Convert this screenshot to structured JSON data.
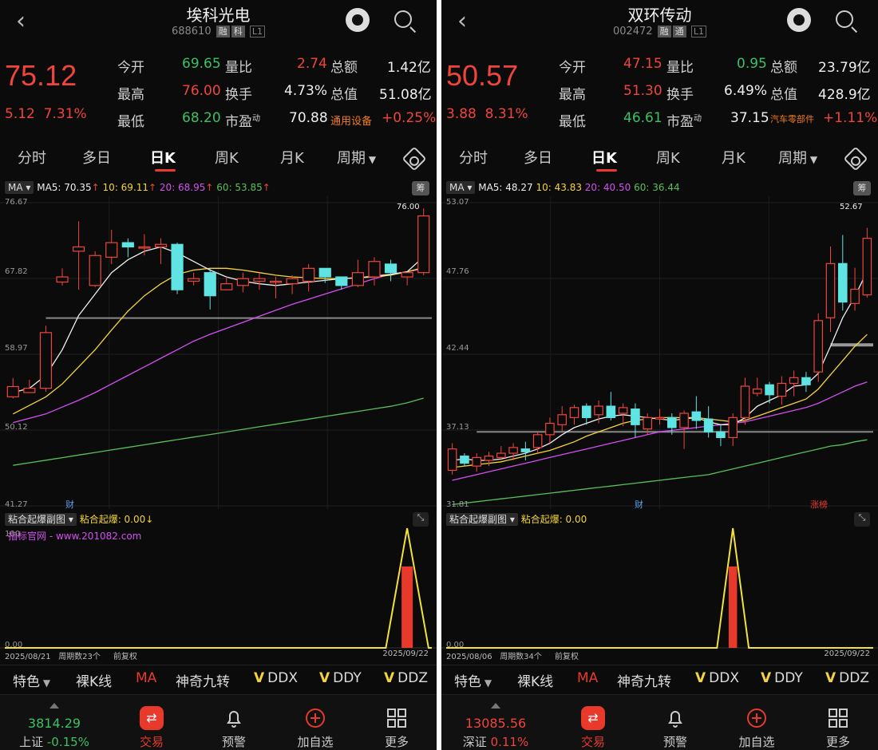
{
  "panels": [
    {
      "stock_name": "埃科光电",
      "stock_code": "688610",
      "tags": [
        "融",
        "科",
        "L1"
      ],
      "price": "75.12",
      "change": "5.12",
      "change_pct": "7.31%",
      "quote": {
        "row1": {
          "l1": "今开",
          "v1": "69.65",
          "l2": "量比",
          "v2": "2.74",
          "l3": "总额",
          "v3": "1.42亿"
        },
        "row2": {
          "l1": "最高",
          "v1": "76.00",
          "l2": "换手",
          "v2": "4.73%",
          "l3": "总值",
          "v3": "51.08亿"
        },
        "row3": {
          "l1": "最低",
          "v1": "68.20",
          "l2": "市盈",
          "sup": "动",
          "v2": "70.88",
          "l3": "通用设备",
          "v3": "+0.25%"
        }
      },
      "tabs": [
        "分时",
        "多日",
        "日K",
        "周K",
        "月K",
        "周期"
      ],
      "active_tab": 2,
      "ma": {
        "label": "MA",
        "ma5": "MA5: 70.35",
        "ma10": "10: 69.11",
        "ma20": "20: 68.95",
        "ma60": "60: 53.85"
      },
      "badge": "筹",
      "y_labels": [
        "76.67",
        "67.82",
        "58.97",
        "50.12",
        "41.27"
      ],
      "high_label": "76.00",
      "event_markers": [
        "财"
      ],
      "sub_title": "粘合起爆副图",
      "sub_value": "粘合起爆: 0.00↓",
      "sub_watermark": "指标官网 - www.201082.com",
      "sub_y": [
        "100",
        "0.00"
      ],
      "footer": {
        "start": "2025/08/21",
        "count": "周期数23个",
        "adj": "前复权",
        "end": "2025/09/22"
      },
      "indicators": {
        "first": "特色",
        "items": [
          "裸K线",
          "MA",
          "神奇九转",
          "DDX",
          "DDY",
          "DDZ"
        ]
      },
      "index": {
        "value": "3814.29",
        "label": "上证",
        "pct": "-0.15%"
      },
      "bottom": [
        "交易",
        "预警",
        "加自选",
        "更多"
      ],
      "chart_data": {
        "type": "candlestick",
        "ylim": [
          41.27,
          76.67
        ],
        "candles": [
          [
            54.0,
            55.2,
            53.8,
            56.2
          ],
          [
            54.5,
            55.0,
            54.5,
            56.0
          ],
          [
            55.0,
            61.5,
            54.6,
            62.3
          ],
          [
            67.4,
            68.0,
            67.0,
            69.0
          ],
          [
            71.0,
            71.5,
            66.5,
            74.5
          ],
          [
            67.0,
            70.5,
            66.8,
            71.0
          ],
          [
            70.3,
            72.0,
            69.5,
            73.5
          ],
          [
            72.0,
            71.5,
            70.3,
            72.5
          ],
          [
            71.5,
            71.5,
            70.5,
            73.0
          ],
          [
            71.5,
            71.8,
            69.5,
            72.5
          ],
          [
            71.8,
            66.5,
            66.0,
            72.0
          ],
          [
            67.5,
            67.8,
            67.0,
            68.5
          ],
          [
            68.5,
            65.8,
            64.2,
            69.0
          ],
          [
            66.5,
            67.2,
            66.5,
            68.0
          ],
          [
            67.0,
            67.8,
            66.2,
            68.5
          ],
          [
            67.5,
            67.8,
            66.5,
            68.5
          ],
          [
            67.5,
            67.5,
            65.5,
            68.0
          ],
          [
            67.2,
            67.8,
            66.0,
            68.2
          ],
          [
            67.5,
            69.0,
            66.3,
            69.5
          ],
          [
            69.0,
            68.0,
            67.3,
            69.0
          ],
          [
            68.0,
            67.0,
            66.5,
            68.0
          ],
          [
            67.0,
            68.5,
            66.8,
            70.0
          ],
          [
            68.0,
            69.8,
            67.0,
            70.3
          ],
          [
            69.5,
            68.5,
            67.5,
            70.0
          ],
          [
            68.0,
            68.5,
            67.0,
            68.5
          ],
          [
            68.5,
            75.12,
            68.2,
            76.0
          ]
        ],
        "ma5": [
          54.5,
          55.0,
          56.5,
          59.5,
          63.5,
          66.0,
          68.5,
          70.0,
          71.0,
          71.5,
          70.8,
          69.8,
          68.8,
          68.0,
          67.5,
          67.2,
          67.0,
          67.2,
          67.4,
          67.6,
          67.8,
          67.9,
          68.1,
          68.3,
          68.6,
          70.35
        ],
        "ma10": [
          52.0,
          53.0,
          54.0,
          55.5,
          57.5,
          59.5,
          61.8,
          64.0,
          65.8,
          67.2,
          68.3,
          68.8,
          69.0,
          69.0,
          68.8,
          68.5,
          68.2,
          68.0,
          67.9,
          67.8,
          67.8,
          67.9,
          68.0,
          68.2,
          68.6,
          69.11
        ],
        "ma20": [
          51.0,
          51.5,
          52.0,
          52.8,
          53.6,
          54.5,
          55.5,
          56.5,
          57.5,
          58.5,
          59.5,
          60.5,
          61.3,
          62.0,
          62.7,
          63.4,
          64.1,
          64.8,
          65.4,
          66.0,
          66.6,
          67.2,
          67.8,
          68.3,
          68.6,
          68.95
        ],
        "ma60": [
          46.0,
          46.3,
          46.6,
          46.9,
          47.2,
          47.5,
          47.8,
          48.1,
          48.4,
          48.7,
          49.0,
          49.3,
          49.6,
          49.9,
          50.2,
          50.5,
          50.8,
          51.1,
          51.4,
          51.7,
          52.0,
          52.3,
          52.6,
          52.9,
          53.3,
          53.85
        ],
        "ref_line": 63.2,
        "sub": {
          "peak_index": 24,
          "peak_value": 100,
          "bar_value": 68
        }
      }
    },
    {
      "stock_name": "双环传动",
      "stock_code": "002472",
      "tags": [
        "融",
        "通",
        "L1"
      ],
      "price": "50.57",
      "change": "3.88",
      "change_pct": "8.31%",
      "quote": {
        "row1": {
          "l1": "今开",
          "v1": "47.15",
          "l2": "量比",
          "v2": "0.95",
          "l3": "总额",
          "v3": "23.79亿"
        },
        "row2": {
          "l1": "最高",
          "v1": "51.30",
          "l2": "换手",
          "v2": "6.49%",
          "l3": "总值",
          "v3": "428.9亿"
        },
        "row3": {
          "l1": "最低",
          "v1": "46.61",
          "l2": "市盈",
          "sup": "动",
          "v2": "37.15",
          "l3": "汽车零部件",
          "v3": "+1.11%"
        }
      },
      "tabs": [
        "分时",
        "多日",
        "日K",
        "周K",
        "月K",
        "周期"
      ],
      "active_tab": 2,
      "ma": {
        "label": "MA",
        "ma5": "MA5: 48.27",
        "ma10": "10: 43.83",
        "ma20": "20: 40.50",
        "ma60": "60: 36.44"
      },
      "badge": "筹",
      "y_labels": [
        "53.07",
        "47.76",
        "42.44",
        "37.13",
        "31.81"
      ],
      "high_label": "52.67",
      "event_markers": [
        "财",
        "涨榜"
      ],
      "sub_title": "粘合起爆副图",
      "sub_value": "粘合起爆: 0.00",
      "sub_watermark": "",
      "sub_y": [
        "",
        "0.00"
      ],
      "footer": {
        "start": "2025/08/06",
        "count": "周期数34个",
        "adj": "前复权",
        "end": "2025/09/22"
      },
      "indicators": {
        "first": "特色",
        "items": [
          "裸K线",
          "MA",
          "神奇九转",
          "DDX",
          "DDY",
          "DDZ"
        ]
      },
      "index": {
        "value": "13085.56",
        "label": "深证",
        "pct": "0.11%"
      },
      "bottom": [
        "交易",
        "预警",
        "加自选",
        "更多"
      ],
      "chart_data": {
        "type": "candlestick",
        "ylim": [
          31.81,
          53.07
        ],
        "candles": [
          [
            34.3,
            35.8,
            34.0,
            36.2
          ],
          [
            35.3,
            34.8,
            34.6,
            35.5
          ],
          [
            34.6,
            35.2,
            34.2,
            35.5
          ],
          [
            35.0,
            35.3,
            34.6,
            35.6
          ],
          [
            35.2,
            35.5,
            35.0,
            36.0
          ],
          [
            35.5,
            35.9,
            35.0,
            36.2
          ],
          [
            35.8,
            35.6,
            35.0,
            36.3
          ],
          [
            35.9,
            36.8,
            35.5,
            37.0
          ],
          [
            36.8,
            37.6,
            36.2,
            38.0
          ],
          [
            37.5,
            38.2,
            37.0,
            38.8
          ],
          [
            38.0,
            38.7,
            37.5,
            38.9
          ],
          [
            38.8,
            38.0,
            37.5,
            39.0
          ],
          [
            38.2,
            38.8,
            37.6,
            39.2
          ],
          [
            38.8,
            38.0,
            37.8,
            39.8
          ],
          [
            38.3,
            38.7,
            37.4,
            39.0
          ],
          [
            38.6,
            37.5,
            36.6,
            39.0
          ],
          [
            37.2,
            38.0,
            36.8,
            38.3
          ],
          [
            37.9,
            38.0,
            37.5,
            38.6
          ],
          [
            38.0,
            37.3,
            36.8,
            38.3
          ],
          [
            37.3,
            38.3,
            35.8,
            38.5
          ],
          [
            38.4,
            37.8,
            37.2,
            39.5
          ],
          [
            37.9,
            37.0,
            36.6,
            38.8
          ],
          [
            37.0,
            36.6,
            36.0,
            37.5
          ],
          [
            36.6,
            38.0,
            36.0,
            38.3
          ],
          [
            38.0,
            40.2,
            37.5,
            40.8
          ],
          [
            39.7,
            40.0,
            39.5,
            40.8
          ],
          [
            40.3,
            39.6,
            39.0,
            40.5
          ],
          [
            39.5,
            40.4,
            38.9,
            40.9
          ],
          [
            40.4,
            40.8,
            39.5,
            41.3
          ],
          [
            40.8,
            40.3,
            39.8,
            41.2
          ],
          [
            41.2,
            44.8,
            40.5,
            45.3
          ],
          [
            45.0,
            48.8,
            44.0,
            50.0
          ],
          [
            48.8,
            46.1,
            45.5,
            50.8
          ],
          [
            46.0,
            47.0,
            45.5,
            48.5
          ],
          [
            46.6,
            50.57,
            46.4,
            51.3
          ]
        ],
        "ma5": [
          35.0,
          35.1,
          35.0,
          35.0,
          35.1,
          35.3,
          35.5,
          35.8,
          36.2,
          36.8,
          37.3,
          37.6,
          37.9,
          38.1,
          38.2,
          38.1,
          38.0,
          37.9,
          37.8,
          37.9,
          38.0,
          37.7,
          37.5,
          37.5,
          38.0,
          38.8,
          39.2,
          39.6,
          40.2,
          40.3,
          41.1,
          43.0,
          45.0,
          46.5,
          48.27
        ],
        "ma10": [
          34.5,
          34.6,
          34.7,
          34.8,
          34.9,
          35.1,
          35.3,
          35.5,
          35.7,
          36.0,
          36.3,
          36.7,
          37.0,
          37.3,
          37.6,
          37.8,
          37.9,
          38.0,
          38.0,
          38.0,
          38.0,
          37.9,
          37.8,
          37.7,
          37.8,
          38.1,
          38.4,
          38.7,
          39.0,
          39.3,
          40.0,
          41.0,
          42.0,
          43.0,
          43.83
        ],
        "ma20": [
          33.6,
          33.8,
          34.0,
          34.2,
          34.4,
          34.6,
          34.8,
          35.0,
          35.2,
          35.4,
          35.6,
          35.8,
          36.0,
          36.2,
          36.4,
          36.6,
          36.8,
          37.0,
          37.1,
          37.2,
          37.3,
          37.4,
          37.5,
          37.6,
          37.7,
          37.9,
          38.1,
          38.3,
          38.5,
          38.7,
          39.0,
          39.4,
          39.8,
          40.2,
          40.5
        ],
        "ma60": [
          31.9,
          32.0,
          32.1,
          32.2,
          32.3,
          32.4,
          32.5,
          32.6,
          32.7,
          32.8,
          32.9,
          33.0,
          33.1,
          33.2,
          33.3,
          33.4,
          33.5,
          33.6,
          33.7,
          33.8,
          33.9,
          34.0,
          34.2,
          34.4,
          34.6,
          34.8,
          35.0,
          35.2,
          35.4,
          35.6,
          35.8,
          36.0,
          36.1,
          36.3,
          36.44
        ],
        "ref_line": 37.0,
        "ref_line2": 43.1,
        "sub": {
          "peak_index": 23,
          "peak_value": 100,
          "bar_value": 68
        }
      }
    }
  ]
}
